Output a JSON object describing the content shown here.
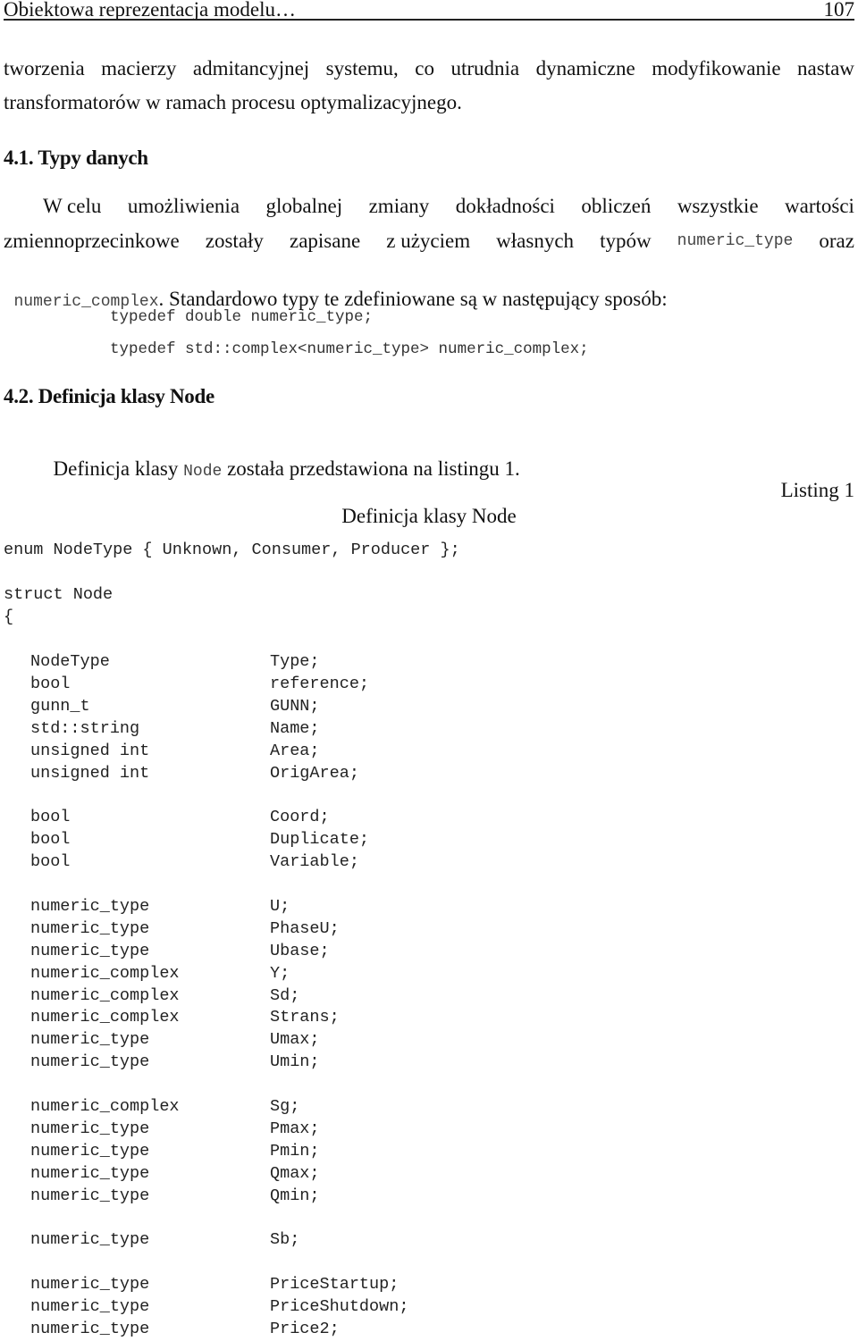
{
  "header": {
    "running_title": "Obiektowa reprezentacja modelu…",
    "page_number": "107"
  },
  "intro": {
    "line1": [
      "tworzenia",
      "macierzy",
      "admitancyjnej",
      "systemu,",
      "co",
      "utrudnia",
      "dynamiczne",
      "modyfikowanie",
      "nastaw"
    ],
    "line2": "transformatorów w ramach procesu optymalizacyjnego."
  },
  "section_4_1": {
    "heading": "4.1. Typy danych",
    "p_line1": [
      "W celu",
      "umożliwienia",
      "globalnej",
      "zmiany",
      "dokładności",
      "obliczeń",
      "wszystkie",
      "wartości"
    ],
    "p_line2": [
      "zmiennoprzecinkowe",
      "zostały",
      "zapisane",
      "z użyciem",
      "własnych",
      "typów"
    ],
    "p_line2_code": "numeric_type",
    "p_line2_end": "oraz",
    "p_line3_code": "numeric_complex",
    "p_line3_text": ". Standardowo typy te zdefiniowane są w następujący sposób:",
    "typedefs": [
      "typedef double numeric_type;",
      "typedef std::complex<numeric_type> numeric_complex;"
    ]
  },
  "section_4_2": {
    "heading": "4.2. Definicja klasy Node",
    "p_before": "Definicja klasy ",
    "p_code": "Node",
    "p_after": " została przedstawiona na listingu 1."
  },
  "listing": {
    "number_label": "Listing 1",
    "caption": "Definicja klasy Node",
    "enum_line": "enum NodeType { Unknown, Consumer, Producer };",
    "struct_line": "struct Node",
    "open_brace": "{",
    "members": [
      {
        "type": "NodeType",
        "name": "Type;"
      },
      {
        "type": "bool",
        "name": "reference;"
      },
      {
        "type": "gunn_t",
        "name": "GUNN;"
      },
      {
        "type": "std::string",
        "name": "Name;"
      },
      {
        "type": "unsigned int",
        "name": "Area;"
      },
      {
        "type": "unsigned int",
        "name": "OrigArea;"
      },
      {
        "type": "bool",
        "name": "Coord;"
      },
      {
        "type": "bool",
        "name": "Duplicate;"
      },
      {
        "type": "bool",
        "name": "Variable;"
      },
      {
        "type": "numeric_type",
        "name": "U;"
      },
      {
        "type": "numeric_type",
        "name": "PhaseU;"
      },
      {
        "type": "numeric_type",
        "name": "Ubase;"
      },
      {
        "type": "numeric_complex",
        "name": "Y;"
      },
      {
        "type": "numeric_complex",
        "name": "Sd;"
      },
      {
        "type": "numeric_complex",
        "name": "Strans;"
      },
      {
        "type": "numeric_type",
        "name": "Umax;"
      },
      {
        "type": "numeric_type",
        "name": "Umin;"
      },
      {
        "type": "numeric_complex",
        "name": "Sg;"
      },
      {
        "type": "numeric_type",
        "name": "Pmax;"
      },
      {
        "type": "numeric_type",
        "name": "Pmin;"
      },
      {
        "type": "numeric_type",
        "name": "Qmax;"
      },
      {
        "type": "numeric_type",
        "name": "Qmin;"
      },
      {
        "type": "numeric_type",
        "name": "Sb;"
      },
      {
        "type": "numeric_type",
        "name": "PriceStartup;"
      },
      {
        "type": "numeric_type",
        "name": "PriceShutdown;"
      },
      {
        "type": "numeric_type",
        "name": "Price2;"
      }
    ]
  }
}
